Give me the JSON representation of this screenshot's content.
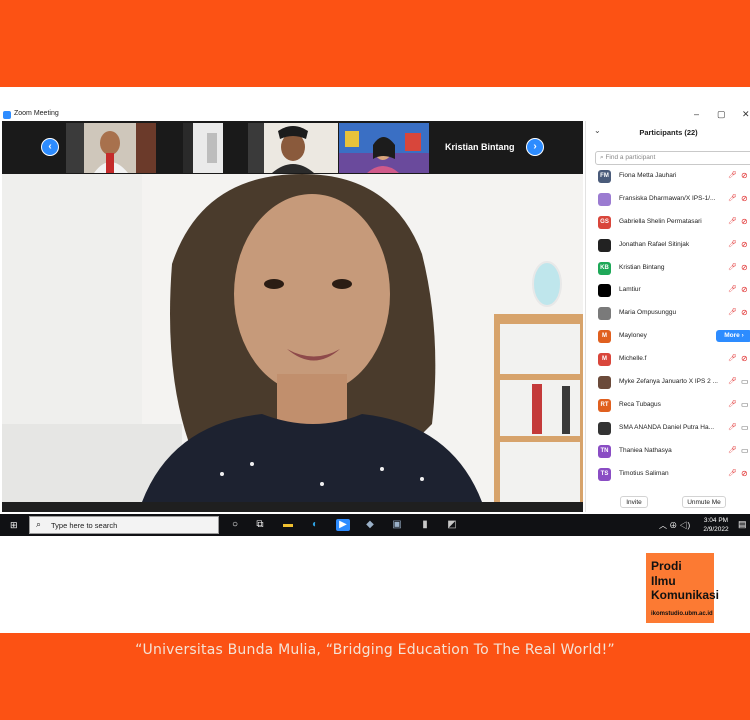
{
  "window": {
    "title": "Zoom Meeting",
    "controls": {
      "minimize": "–",
      "restore": "▢",
      "close": "✕"
    }
  },
  "video_strip": {
    "prev_icon": "chevron-left-icon",
    "next_icon": "chevron-right-icon",
    "active_name": "Kristian Bintang"
  },
  "participants_panel": {
    "title": "Participants (22)",
    "collapse_icon": "chevron-down-icon",
    "search_placeholder": "Find a participant",
    "items": [
      {
        "initials": "FM",
        "name": "Fiona Metta Jauhari",
        "avatar_color": "#4a5b7a",
        "mic": "muted",
        "video": "off"
      },
      {
        "initials": "",
        "name": "Fransiska Dharmawan/X IPS-1/...",
        "avatar_color": "#9b7bd1",
        "mic": "muted",
        "video": "off"
      },
      {
        "initials": "GS",
        "name": "Gabriella Shelin Permatasari",
        "avatar_color": "#d9463b",
        "mic": "muted",
        "video": "off"
      },
      {
        "initials": "",
        "name": "Jonathan Rafael Sitinjak",
        "avatar_color": "#222222",
        "mic": "muted",
        "video": "off"
      },
      {
        "initials": "KB",
        "name": "Kristian Bintang",
        "avatar_color": "#1ea858",
        "mic": "muted",
        "video": "off"
      },
      {
        "initials": "",
        "name": "Lamtiur",
        "avatar_color": "#000000",
        "mic": "muted",
        "video": "off"
      },
      {
        "initials": "",
        "name": "Maria Ompusunggu",
        "avatar_color": "#7a7a7a",
        "mic": "muted",
        "video": "off"
      },
      {
        "initials": "M",
        "name": "Mayloney",
        "avatar_color": "#e0601f",
        "more": "More ›"
      },
      {
        "initials": "M",
        "name": "Michelle.f",
        "avatar_color": "#d9463b",
        "mic": "muted",
        "video": "off"
      },
      {
        "initials": "",
        "name": "Myke Zefanya Januarto X IPS 2 ...",
        "avatar_color": "#6b4a3a",
        "mic": "muted",
        "video": "on"
      },
      {
        "initials": "RT",
        "name": "Reca Tubagus",
        "avatar_color": "#e0601f",
        "mic": "muted",
        "video": "on"
      },
      {
        "initials": "",
        "name": "SMA ANANDA Daniel Putra Ha...",
        "avatar_color": "#333333",
        "mic": "muted",
        "video": "on"
      },
      {
        "initials": "TN",
        "name": "Thaniea Nathasya",
        "avatar_color": "#8a4dc4",
        "mic": "muted",
        "video": "on"
      },
      {
        "initials": "TS",
        "name": "Timotius Saliman",
        "avatar_color": "#8a4dc4",
        "mic": "muted",
        "video": "off"
      }
    ],
    "invite_label": "Invite",
    "unmute_label": "Unmute Me"
  },
  "taskbar": {
    "search_placeholder": "Type here to search",
    "time": "3:04 PM",
    "date": "2/9/2022"
  },
  "branding": {
    "logo_line1": "Prodi",
    "logo_line2": "Ilmu",
    "logo_line3": "Komunikasi",
    "logo_url": "ikomstudio.ubm.ac.id",
    "tagline": "“Universitas Bunda Mulia, “Bridging Education To The Real World!”",
    "accent_color": "#fc5214"
  }
}
